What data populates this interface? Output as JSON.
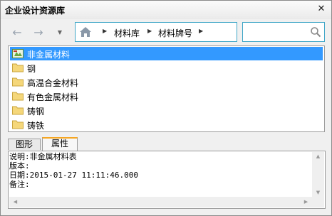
{
  "window": {
    "title": "企业设计资源库",
    "close_glyph": "✕"
  },
  "nav": {
    "back_glyph": "←",
    "forward_glyph": "→",
    "dropdown_glyph": "▼"
  },
  "breadcrumb": [
    {
      "label": "材料库"
    },
    {
      "label": "材料牌号"
    }
  ],
  "breadcrumb_arrow": "▶",
  "search": {
    "value": "",
    "placeholder": ""
  },
  "tree": {
    "items": [
      {
        "label": "非金属材料",
        "icon": "material-icon",
        "selected": true
      },
      {
        "label": "钢",
        "icon": "folder-icon",
        "selected": false
      },
      {
        "label": "高温合金材料",
        "icon": "folder-icon",
        "selected": false
      },
      {
        "label": "有色金属材料",
        "icon": "folder-icon",
        "selected": false
      },
      {
        "label": "铸钢",
        "icon": "folder-icon",
        "selected": false
      },
      {
        "label": "铸铁",
        "icon": "folder-icon",
        "selected": false
      }
    ]
  },
  "tabs": [
    {
      "label": "图形",
      "active": false
    },
    {
      "label": "属性",
      "active": true
    }
  ],
  "properties": {
    "description": "说明:非金属材料表",
    "version": "版本:",
    "date": "日期:2015-01-27 11:11:46.000",
    "remark": "备注:"
  },
  "colors": {
    "selection": "#3399ff",
    "accent_border": "#3fa6c7",
    "active_tab_top": "#f6a623"
  }
}
